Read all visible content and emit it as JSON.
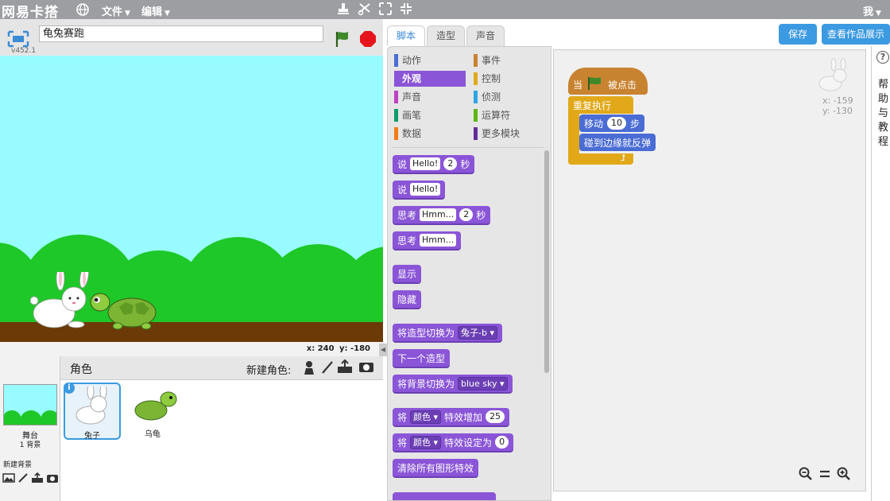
{
  "app": {
    "name": "网易卡搭",
    "menus": [
      "文件",
      "编辑"
    ],
    "user": "我"
  },
  "project": {
    "title": "龟兔赛跑",
    "version": "v452.1"
  },
  "stage": {
    "mouse_x": "x: 240",
    "mouse_y": "y: -180"
  },
  "sprites": {
    "header": "角色",
    "new_sprite": "新建角色:",
    "stage_label": "舞台",
    "stage_sub": "1 背景",
    "new_backdrop": "新建背景",
    "list": [
      {
        "name": "兔子"
      },
      {
        "name": "乌龟"
      }
    ]
  },
  "tabs": [
    "脚本",
    "造型",
    "声音"
  ],
  "buttons": {
    "save": "保存",
    "view": "查看作品展示"
  },
  "categories": [
    {
      "label": "动作",
      "color": "#4a6cd4"
    },
    {
      "label": "事件",
      "color": "#c88330"
    },
    {
      "label": "外观",
      "color": "#8a55d7"
    },
    {
      "label": "控制",
      "color": "#e1a91a"
    },
    {
      "label": "声音",
      "color": "#bb42c3"
    },
    {
      "label": "侦测",
      "color": "#2ca5e2"
    },
    {
      "label": "画笔",
      "color": "#0e9a6c"
    },
    {
      "label": "运算符",
      "color": "#5cb712"
    },
    {
      "label": "数据",
      "color": "#ee7d16"
    },
    {
      "label": "更多模块",
      "color": "#632d99"
    }
  ],
  "blocks": {
    "say_secs": {
      "a": "说",
      "v": "Hello!",
      "n": "2",
      "b": "秒"
    },
    "say": {
      "a": "说",
      "v": "Hello!"
    },
    "think_secs": {
      "a": "思考",
      "v": "Hmm...",
      "n": "2",
      "b": "秒"
    },
    "think": {
      "a": "思考",
      "v": "Hmm..."
    },
    "show": "显示",
    "hide": "隐藏",
    "switch_costume": {
      "a": "将造型切换为",
      "v": "兔子-b"
    },
    "next_costume": "下一个造型",
    "switch_backdrop": {
      "a": "将背景切换为",
      "v": "blue sky"
    },
    "change_effect": {
      "a": "将",
      "v": "颜色",
      "b": "特效增加",
      "n": "25"
    },
    "set_effect": {
      "a": "将",
      "v": "颜色",
      "b": "特效设定为",
      "n": "0"
    },
    "clear_effects": "清除所有图形特效"
  },
  "script": {
    "hat_a": "当",
    "hat_b": "被点击",
    "forever": "重复执行",
    "move_a": "移动",
    "move_n": "10",
    "move_b": "步",
    "bounce": "碰到边缘就反弹"
  },
  "sprite_info": {
    "x": "x: -159",
    "y": "y: -130"
  },
  "help_text": "帮助与教程"
}
